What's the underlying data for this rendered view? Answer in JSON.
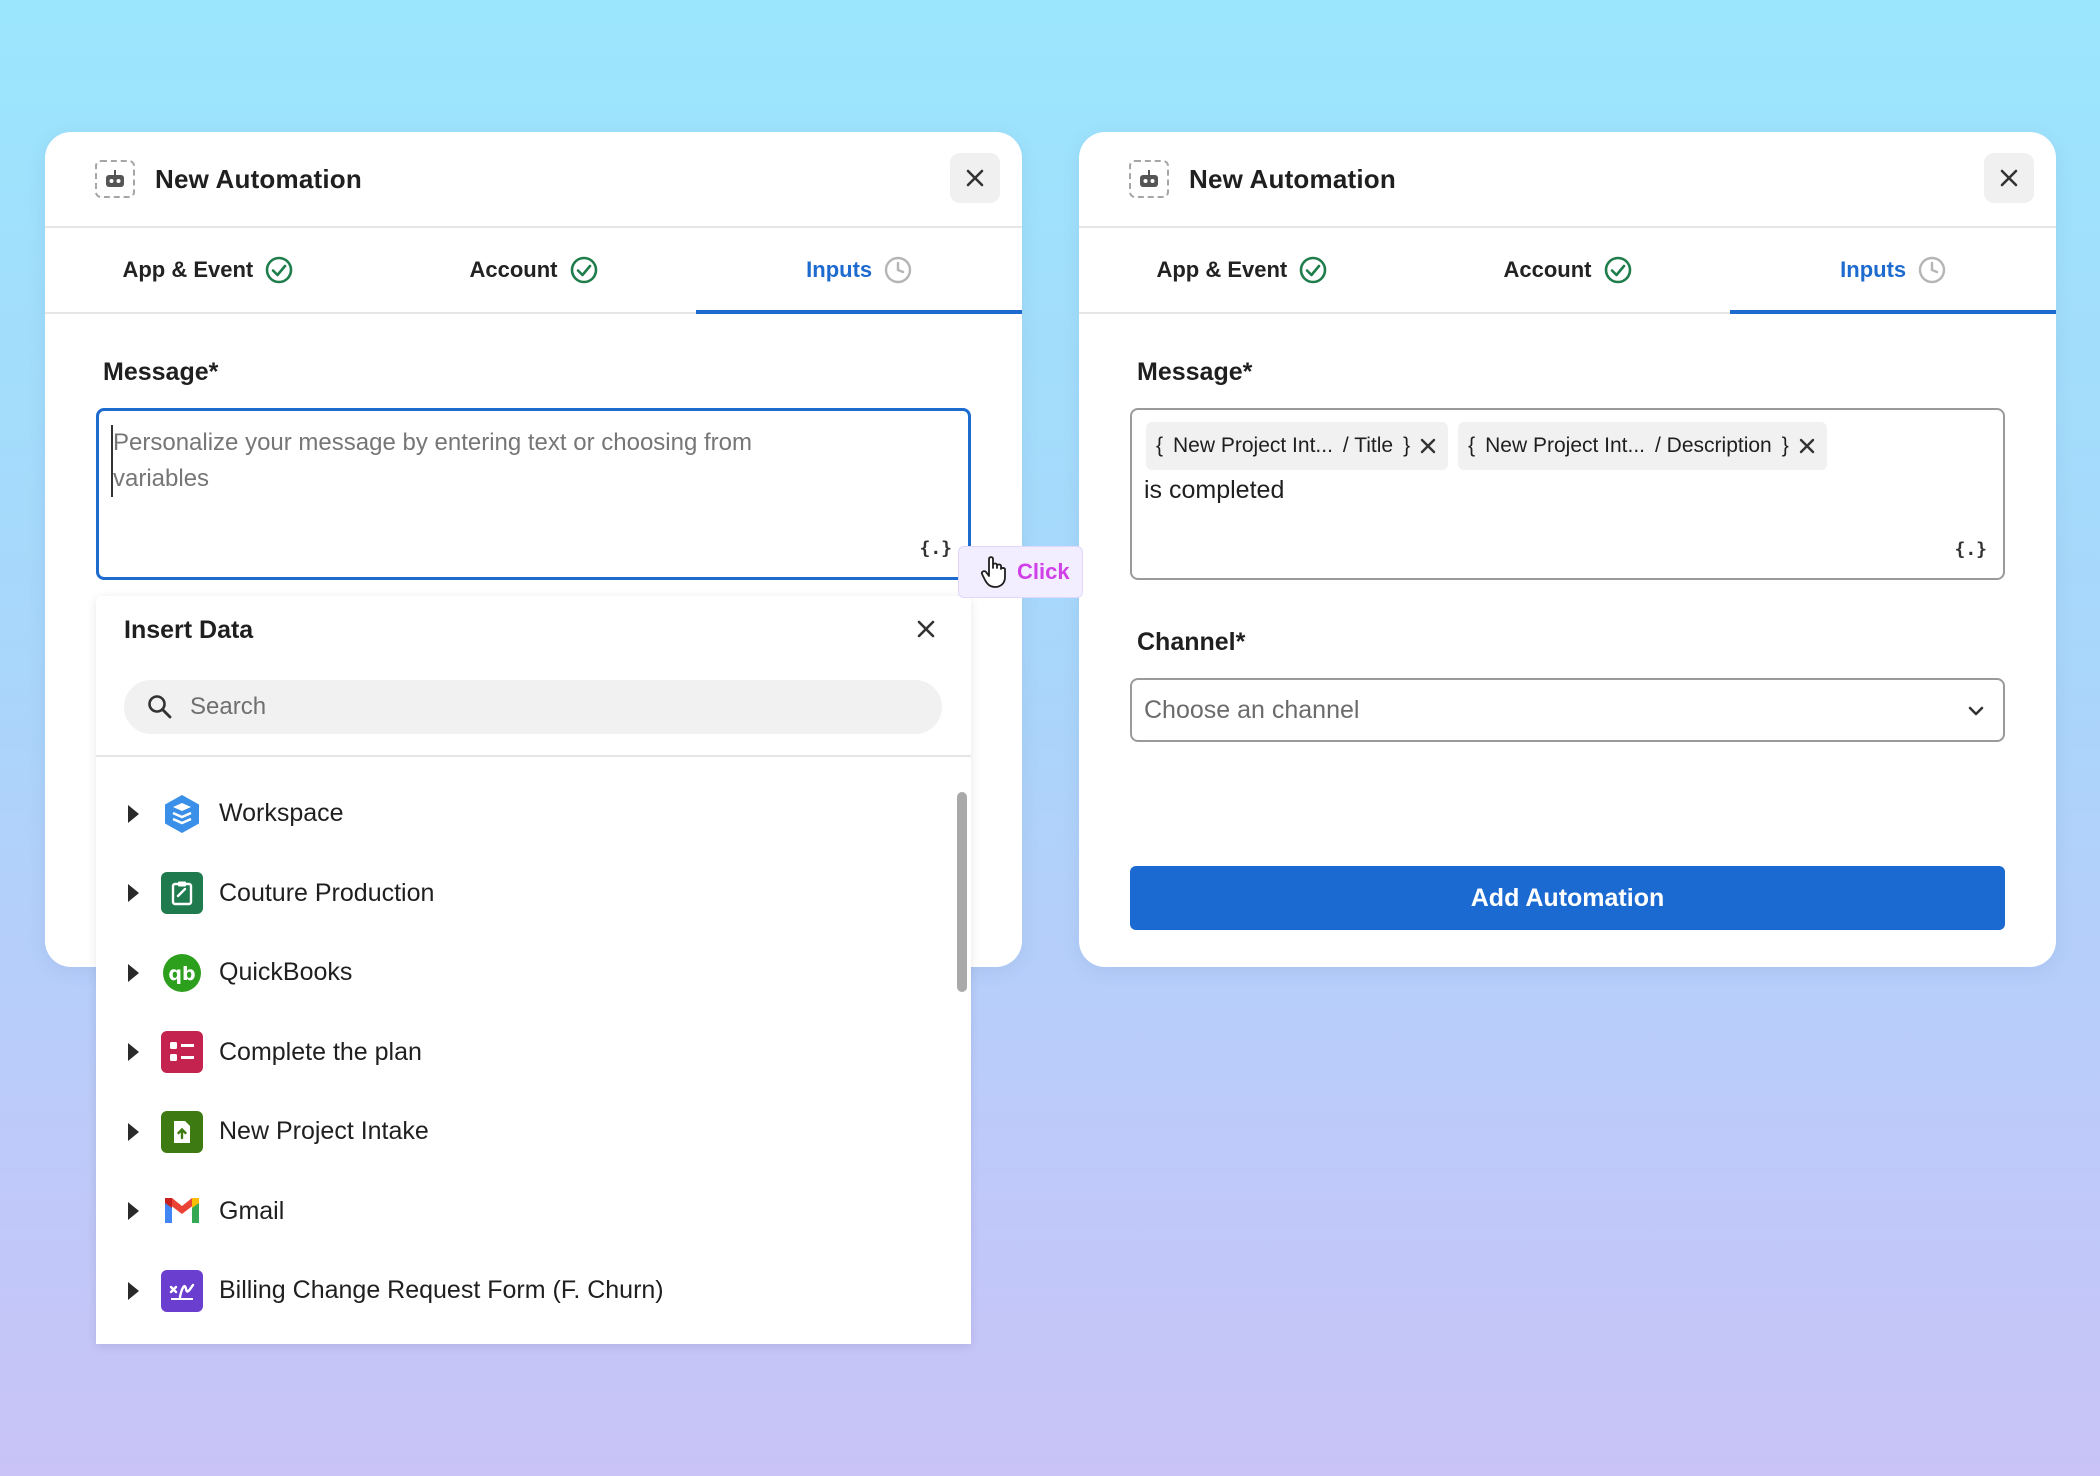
{
  "colors": {
    "accent": "#1e6bd0",
    "success": "#1e7d4b",
    "click": "#d040e8"
  },
  "left": {
    "title": "New Automation",
    "tabs": [
      {
        "label": "App & Event",
        "status": "done"
      },
      {
        "label": "Account",
        "status": "done"
      },
      {
        "label": "Inputs",
        "status": "pending"
      }
    ],
    "message_label": "Message*",
    "message_placeholder": "Personalize your message by entering text or choosing from variables",
    "var_button": "{.}"
  },
  "insert_data": {
    "title": "Insert Data",
    "search_placeholder": "Search",
    "items": [
      {
        "label": "Workspace",
        "icon": "workspace-icon"
      },
      {
        "label": "Couture Production",
        "icon": "clipboard-icon"
      },
      {
        "label": "QuickBooks",
        "icon": "quickbooks-icon"
      },
      {
        "label": "Complete the plan",
        "icon": "checklist-icon"
      },
      {
        "label": "New Project Intake",
        "icon": "upload-doc-icon"
      },
      {
        "label": "Gmail",
        "icon": "gmail-icon"
      },
      {
        "label": "Billing Change Request Form (F. Churn)",
        "icon": "signature-icon"
      }
    ]
  },
  "click_hint": "Click",
  "right": {
    "title": "New Automation",
    "tabs": [
      {
        "label": "App & Event",
        "status": "done"
      },
      {
        "label": "Account",
        "status": "done"
      },
      {
        "label": "Inputs",
        "status": "pending"
      }
    ],
    "message_label": "Message*",
    "chips": [
      {
        "source": "New Project Int...",
        "field": "/ Title"
      },
      {
        "source": "New Project Int...",
        "field": "/ Description"
      }
    ],
    "message_text": "is completed",
    "var_button": "{.}",
    "channel_label": "Channel*",
    "channel_placeholder": "Choose an channel",
    "submit_label": "Add Automation"
  }
}
